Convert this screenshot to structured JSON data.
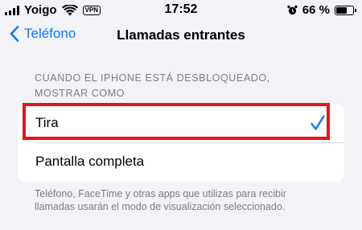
{
  "status_bar": {
    "carrier": "Yoigo",
    "vpn_badge": "VPN",
    "time": "17:52",
    "battery_percent": "66 %",
    "battery_level": 0.66,
    "icons": [
      "signal-icon",
      "wifi-icon",
      "alarm-icon",
      "battery-icon"
    ]
  },
  "nav": {
    "back_label": "Teléfono",
    "title": "Llamadas entrantes"
  },
  "section": {
    "header": "CUANDO EL IPHONE ESTÁ DESBLOQUEADO, MOSTRAR COMO",
    "options": [
      {
        "label": "Tira",
        "selected": true
      },
      {
        "label": "Pantalla completa",
        "selected": false
      }
    ],
    "footer": "Teléfono, FaceTime y otras apps que utilizas para recibir llamadas usarán el modo de visualización seleccionado."
  },
  "colors": {
    "accent": "#0a7aff",
    "highlight": "#e8141b",
    "background": "#f2f2f7"
  }
}
